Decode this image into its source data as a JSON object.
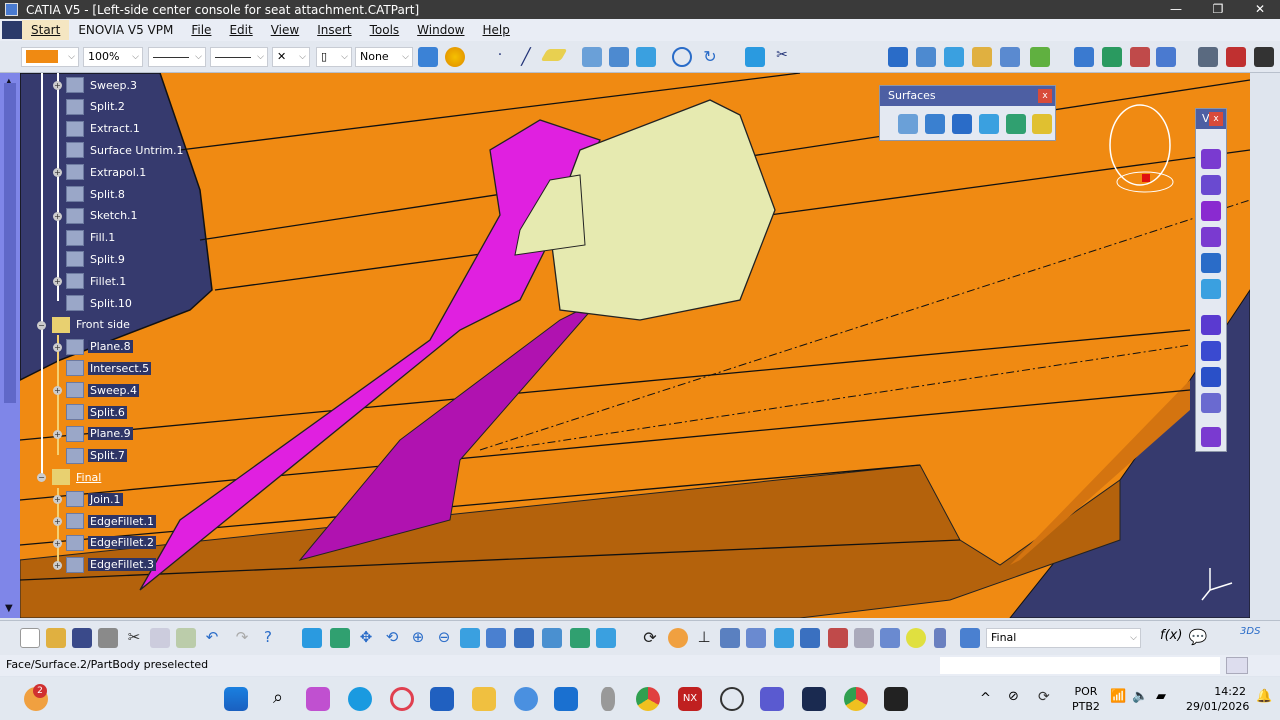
{
  "window": {
    "title": "CATIA V5 - [Left-side center console for seat attachment.CATPart]",
    "minimize": "—",
    "restore": "❐",
    "close": "✕"
  },
  "menu": {
    "items": [
      "Start",
      "ENOVIA V5 VPM",
      "File",
      "Edit",
      "View",
      "Insert",
      "Tools",
      "Window",
      "Help"
    ]
  },
  "toolbar": {
    "color_swatch": "#f08a12",
    "zoom": "100%",
    "layer": "None"
  },
  "tree": {
    "items": [
      {
        "label": "Sweep.3",
        "level": 2,
        "plus": true
      },
      {
        "label": "Split.2",
        "level": 2
      },
      {
        "label": "Extract.1",
        "level": 2
      },
      {
        "label": "Surface Untrim.1",
        "level": 2
      },
      {
        "label": "Extrapol.1",
        "level": 2,
        "plus": true
      },
      {
        "label": "Split.8",
        "level": 2
      },
      {
        "label": "Sketch.1",
        "level": 2,
        "plus": true
      },
      {
        "label": "Fill.1",
        "level": 2
      },
      {
        "label": "Split.9",
        "level": 2
      },
      {
        "label": "Fillet.1",
        "level": 2,
        "plus": true
      },
      {
        "label": "Split.10",
        "level": 2
      },
      {
        "label": "Front side",
        "level": 1,
        "minus": true
      },
      {
        "label": "Plane.8",
        "level": 2,
        "plus": true,
        "sel": true
      },
      {
        "label": "Intersect.5",
        "level": 2,
        "sel": true
      },
      {
        "label": "Sweep.4",
        "level": 2,
        "plus": true,
        "sel": true
      },
      {
        "label": "Split.6",
        "level": 2,
        "sel": true
      },
      {
        "label": "Plane.9",
        "level": 2,
        "plus": true,
        "sel": true
      },
      {
        "label": "Split.7",
        "level": 2,
        "sel": true
      },
      {
        "label": "Final",
        "level": 1,
        "minus": true,
        "underline": true
      },
      {
        "label": "Join.1",
        "level": 2,
        "plus": true,
        "sel": true
      },
      {
        "label": "EdgeFillet.1",
        "level": 2,
        "plus": true,
        "sel": true
      },
      {
        "label": "EdgeFillet.2",
        "level": 2,
        "plus": true,
        "sel": true
      },
      {
        "label": "EdgeFillet.3",
        "level": 2,
        "plus": true,
        "sel": true
      }
    ]
  },
  "surfaces_toolbar": {
    "title": "Surfaces",
    "close": "x"
  },
  "right_toolbar": {
    "title": "V",
    "close": "x"
  },
  "bottom": {
    "current_body": "Final"
  },
  "status": {
    "message": "Face/Surface.2/PartBody preselected"
  },
  "taskbar": {
    "notification_count": "2",
    "language": "POR",
    "layout": "PTB2",
    "time": "14:22",
    "date": "29/01/2026"
  },
  "colors": {
    "viewport": "#f08a12",
    "magenta": "#e020e0",
    "tree_bg": "#363a6e",
    "part_yellow": "#e6eab0"
  }
}
